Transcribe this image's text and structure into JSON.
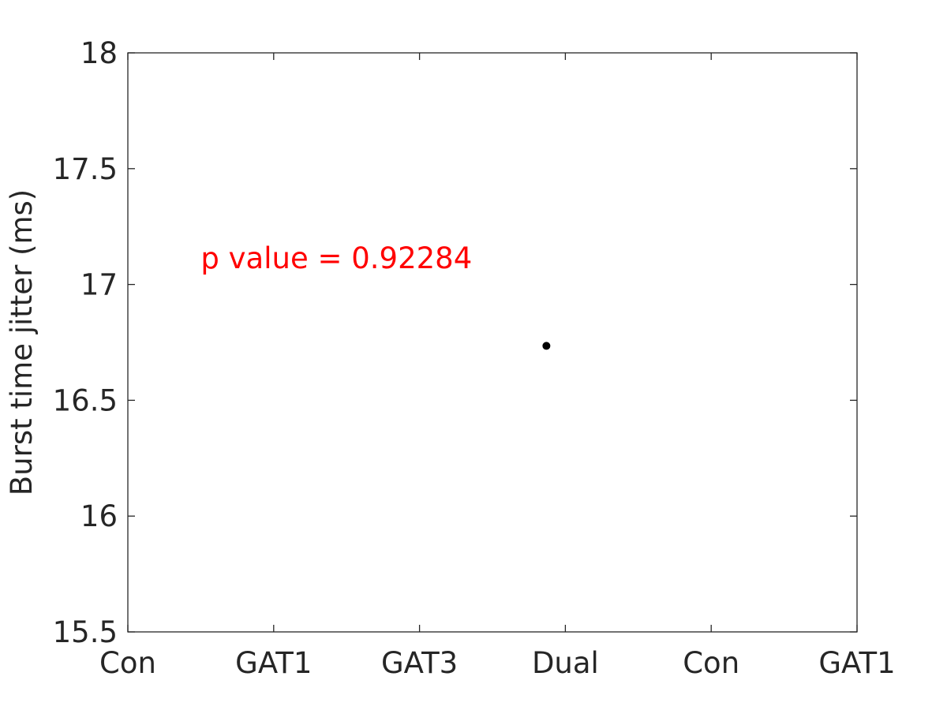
{
  "chart_data": {
    "type": "scatter",
    "title": "",
    "xlabel": "",
    "ylabel": "Burst time jitter (ms)",
    "x_tick_labels": [
      "Con",
      "GAT1",
      "GAT3",
      "Dual",
      "Con",
      "GAT1"
    ],
    "x_ticks": [
      1,
      2,
      3,
      4,
      5,
      6
    ],
    "xlim": [
      1,
      6
    ],
    "y_tick_labels": [
      "15.5",
      "16",
      "16.5",
      "17",
      "17.5",
      "18"
    ],
    "y_ticks": [
      15.5,
      16,
      16.5,
      17,
      17.5,
      18
    ],
    "ylim": [
      15.5,
      18
    ],
    "grid": false,
    "series": [
      {
        "name": "data",
        "color": "#000000",
        "points": [
          {
            "x": 3.87,
            "y": 16.735
          }
        ]
      }
    ],
    "annotations": [
      {
        "text": "p value = 0.92284",
        "x": 1.5,
        "y": 17.07,
        "color": "#ff0000"
      }
    ]
  }
}
